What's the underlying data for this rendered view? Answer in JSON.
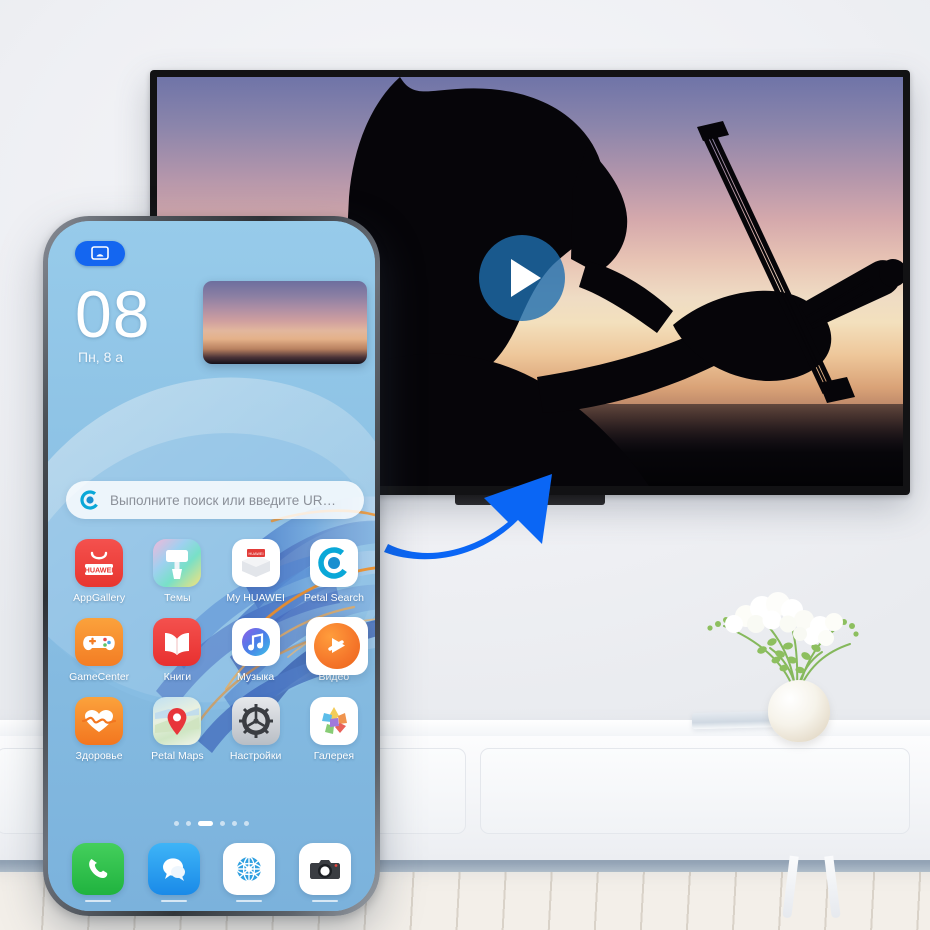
{
  "scene": {
    "title": "Huawei phone casting video to smart TV",
    "wall_color": "#f0f1f4",
    "accent_blue": "#0a66f5",
    "floor_color": "#f3efe9"
  },
  "tv": {
    "name": "smart-tv",
    "content_description": "Silhouette of a violinist playing at sunset",
    "play_button": {
      "label": "Play",
      "icon": "play-icon",
      "color": "#1e6eaf"
    }
  },
  "arrow": {
    "name": "cast-direction-arrow",
    "color": "#0a66f5",
    "direction": "up-right"
  },
  "phone": {
    "cast_badge": {
      "icon": "cast-screen-icon",
      "color": "#1466f0"
    },
    "clock": "08",
    "date": "Пн, 8 а",
    "video_thumbnail": {
      "name": "video-thumbnail",
      "description": "Violinist silhouette at sunset"
    },
    "floating_app": {
      "name": "huawei-video-floating-icon",
      "icon": "play-icon",
      "color": "#f5762a"
    },
    "search": {
      "placeholder": "Выполните поиск или введите UR…",
      "icon": "petal-search-icon"
    },
    "apps": [
      {
        "label": "AppGallery",
        "icon": "appgallery-icon",
        "color": "#ef4444"
      },
      {
        "label": "Темы",
        "icon": "themes-icon",
        "color": "#7fc4e8"
      },
      {
        "label": "My HUAWEI",
        "icon": "my-huawei-icon",
        "color": "#ffffff"
      },
      {
        "label": "Petal Search",
        "icon": "petal-search-icon",
        "color": "#ffffff"
      },
      {
        "label": "GameCenter",
        "icon": "gamecenter-icon",
        "color": "#f68b33"
      },
      {
        "label": "Книги",
        "icon": "books-icon",
        "color": "#ef3b38"
      },
      {
        "label": "Музыка",
        "icon": "music-icon",
        "color": "#ffffff"
      },
      {
        "label": "Видео",
        "icon": "video-icon",
        "color": "#f5762a"
      },
      {
        "label": "Здоровье",
        "icon": "health-icon",
        "color": "#f68b33"
      },
      {
        "label": "Petal Maps",
        "icon": "petal-maps-icon",
        "color": "#cfe3c8"
      },
      {
        "label": "Настройки",
        "icon": "settings-icon",
        "color": "#c9ccd1"
      },
      {
        "label": "Галерея",
        "icon": "gallery-icon",
        "color": "#ffffff"
      }
    ],
    "pages": {
      "count": 6,
      "active_index": 2
    },
    "dock": [
      {
        "label": "Телефон",
        "icon": "phone-icon",
        "color": "#2ec04a"
      },
      {
        "label": "Сообщения",
        "icon": "messages-icon",
        "color": "#2196f3"
      },
      {
        "label": "Браузер",
        "icon": "browser-icon",
        "color": "#ffffff"
      },
      {
        "label": "Камера",
        "icon": "camera-icon",
        "color": "#ffffff"
      }
    ]
  },
  "room": {
    "console": {
      "name": "tv-console"
    },
    "plant": {
      "name": "orchid-plant",
      "description": "White orchids in a round ceramic vase"
    },
    "books": {
      "name": "stacked-books"
    }
  }
}
